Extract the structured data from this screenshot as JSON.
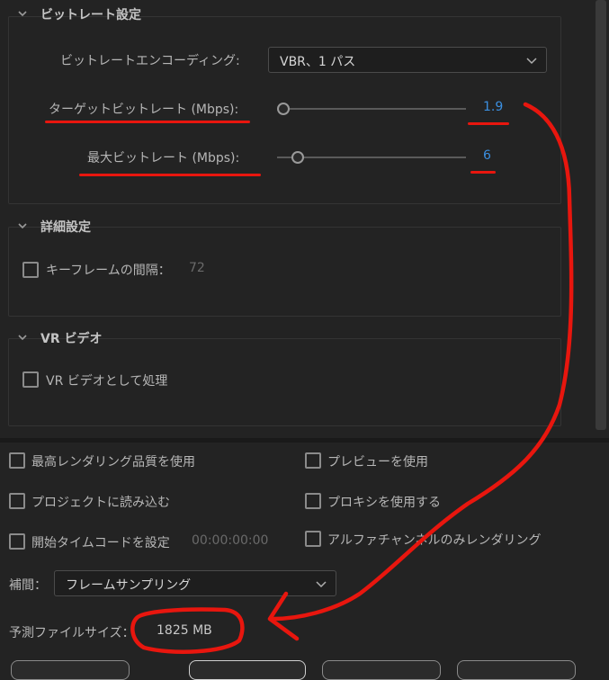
{
  "bitrate_section": {
    "title": "ビットレート設定",
    "encoding_label": "ビットレートエンコーディング:",
    "encoding_value": "VBR、1 パス",
    "target_label": "ターゲットビットレート (Mbps):",
    "target_value": "1.9",
    "max_label": "最大ビットレート (Mbps):",
    "max_value": "6"
  },
  "advanced_section": {
    "title": "詳細設定",
    "keyframe_label": "キーフレームの間隔：",
    "keyframe_value": "72"
  },
  "vr_section": {
    "title": "VR ビデオ",
    "vr_label": "VR ビデオとして処理"
  },
  "options": {
    "max_quality": "最高レンダリング品質を使用",
    "use_preview": "プレビューを使用",
    "import_project": "プロジェクトに読み込む",
    "use_proxy": "プロキシを使用する",
    "set_timecode": "開始タイムコードを設定",
    "timecode_value": "00:00:00:00",
    "alpha_only": "アルファチャンネルのみレンダリング"
  },
  "interpolation": {
    "label": "補間：",
    "value": "フレームサンプリング"
  },
  "file_size": {
    "label": "予測ファイルサイズ：",
    "value": "1825 MB"
  },
  "colors": {
    "accent_blue": "#3b8fe0",
    "annotation_red": "#e8160e"
  }
}
